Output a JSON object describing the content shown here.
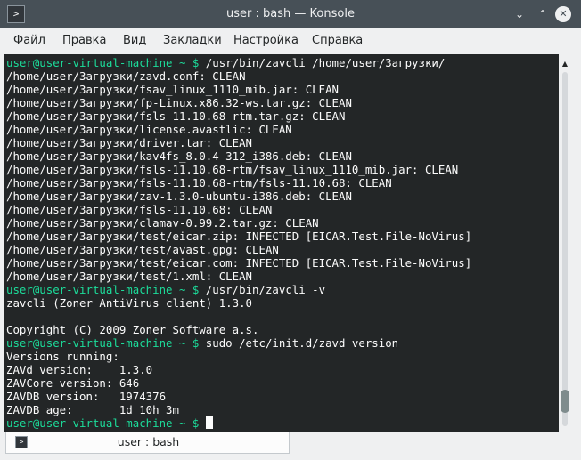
{
  "window": {
    "title": "user : bash — Konsole",
    "icon": "terminal-icon",
    "minimize_glyph": "⌄",
    "maximize_glyph": "⌃",
    "close_glyph": "✕"
  },
  "menu": [
    "Файл",
    "Правка",
    "Вид",
    "Закладки",
    "Настройка",
    "Справка"
  ],
  "terminal": {
    "prompt": "user@user-virtual-machine ~ $",
    "lines": [
      {
        "prompt": true,
        "text": " /usr/bin/zavcli /home/user/Загрузки/"
      },
      {
        "prompt": false,
        "text": "/home/user/Загрузки/zavd.conf: CLEAN"
      },
      {
        "prompt": false,
        "text": "/home/user/Загрузки/fsav_linux_1110_mib.jar: CLEAN"
      },
      {
        "prompt": false,
        "text": "/home/user/Загрузки/fp-Linux.x86.32-ws.tar.gz: CLEAN"
      },
      {
        "prompt": false,
        "text": "/home/user/Загрузки/fsls-11.10.68-rtm.tar.gz: CLEAN"
      },
      {
        "prompt": false,
        "text": "/home/user/Загрузки/license.avastlic: CLEAN"
      },
      {
        "prompt": false,
        "text": "/home/user/Загрузки/driver.tar: CLEAN"
      },
      {
        "prompt": false,
        "text": "/home/user/Загрузки/kav4fs_8.0.4-312_i386.deb: CLEAN"
      },
      {
        "prompt": false,
        "text": "/home/user/Загрузки/fsls-11.10.68-rtm/fsav_linux_1110_mib.jar: CLEAN"
      },
      {
        "prompt": false,
        "text": "/home/user/Загрузки/fsls-11.10.68-rtm/fsls-11.10.68: CLEAN"
      },
      {
        "prompt": false,
        "text": "/home/user/Загрузки/zav-1.3.0-ubuntu-i386.deb: CLEAN"
      },
      {
        "prompt": false,
        "text": "/home/user/Загрузки/fsls-11.10.68: CLEAN"
      },
      {
        "prompt": false,
        "text": "/home/user/Загрузки/clamav-0.99.2.tar.gz: CLEAN"
      },
      {
        "prompt": false,
        "text": "/home/user/Загрузки/test/eicar.zip: INFECTED [EICAR.Test.File-NoVirus]"
      },
      {
        "prompt": false,
        "text": "/home/user/Загрузки/test/avast.gpg: CLEAN"
      },
      {
        "prompt": false,
        "text": "/home/user/Загрузки/test/eicar.com: INFECTED [EICAR.Test.File-NoVirus]"
      },
      {
        "prompt": false,
        "text": "/home/user/Загрузки/test/1.xml: CLEAN"
      },
      {
        "prompt": true,
        "text": " /usr/bin/zavcli -v"
      },
      {
        "prompt": false,
        "text": "zavcli (Zoner AntiVirus client) 1.3.0"
      },
      {
        "prompt": false,
        "text": ""
      },
      {
        "prompt": false,
        "text": "Copyright (C) 2009 Zoner Software a.s."
      },
      {
        "prompt": true,
        "text": " sudo /etc/init.d/zavd version"
      },
      {
        "prompt": false,
        "text": "Versions running:"
      },
      {
        "prompt": false,
        "text": "ZAVd version:    1.3.0"
      },
      {
        "prompt": false,
        "text": "ZAVCore version: 646"
      },
      {
        "prompt": false,
        "text": "ZAVDB version:   1974376"
      },
      {
        "prompt": false,
        "text": "ZAVDB age:       1d 10h 3m"
      },
      {
        "prompt": true,
        "text": " ",
        "cursor": true
      }
    ]
  },
  "tab": {
    "label": "user : bash",
    "icon": "terminal-icon"
  },
  "colors": {
    "terminal_bg": "#232627",
    "terminal_fg": "#fcfcfc",
    "prompt": "#1cdc9a",
    "titlebar": "#475057"
  }
}
